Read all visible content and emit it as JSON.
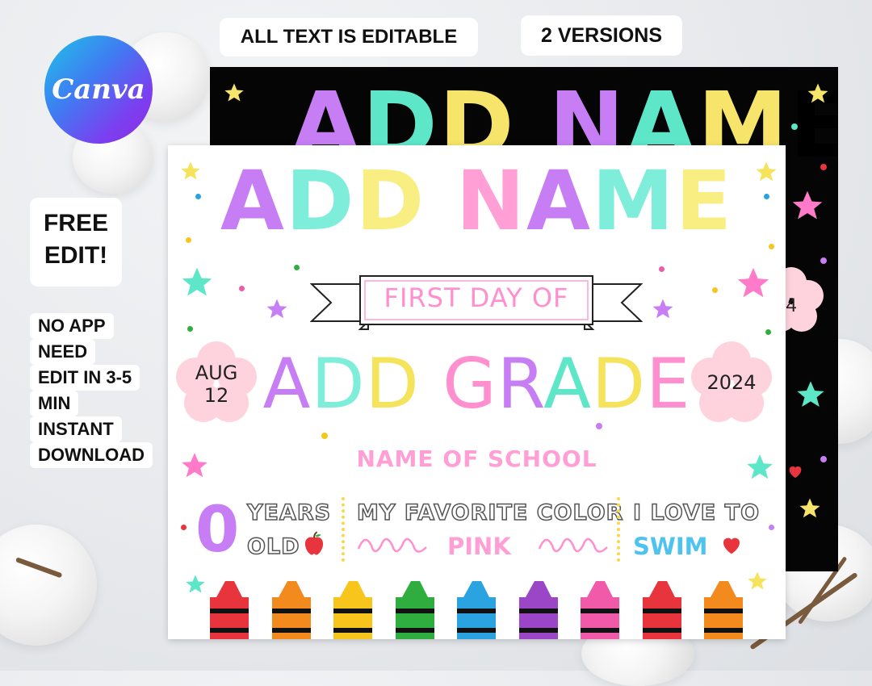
{
  "labels": {
    "editable": "ALL TEXT IS EDITABLE",
    "versions": "2 VERSIONS",
    "free_edit_line1": "FREE",
    "free_edit_line2": "EDIT!",
    "features": [
      "NO APP",
      "NEED",
      "EDIT IN 3-5",
      "MIN",
      "INSTANT",
      "DOWNLOAD"
    ]
  },
  "logo": {
    "text": "Canva"
  },
  "back_card": {
    "title": "ADD NAME",
    "year": "24"
  },
  "front_card": {
    "title": "ADD NAME",
    "banner": "FIRST DAY OF",
    "grade": "ADD GRADE",
    "date_line1": "AUG",
    "date_line2": "12",
    "year": "2024",
    "school": "NAME OF SCHOOL",
    "age": "0",
    "age_label1": "YEARS",
    "age_label2": "OLD",
    "favorite_label": "MY FAVORITE COLOR",
    "favorite_value": "PINK",
    "love_label": "I LOVE TO",
    "love_value": "SWIM"
  },
  "colors": {
    "purple": "#c77ef5",
    "teal": "#5ee6c9",
    "yellow": "#f5e35b",
    "pink": "#ff8fcf",
    "blue": "#4ec3f0",
    "red": "#e8353d"
  },
  "crayon_colors": [
    "#e8353d",
    "#f28a1e",
    "#f7c51b",
    "#2fae3f",
    "#2aa3e0",
    "#9b45c7",
    "#f05aa8",
    "#e8353d",
    "#f28a1e"
  ],
  "icons": [
    "canva-logo-icon",
    "star-icon",
    "flower-icon",
    "ribbon-banner-icon",
    "apple-icon",
    "heart-icon",
    "crayon-icon",
    "swirl-icon"
  ]
}
